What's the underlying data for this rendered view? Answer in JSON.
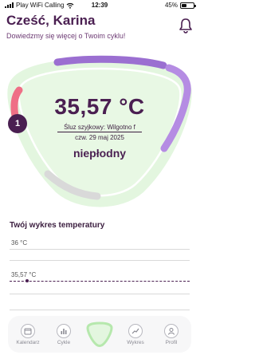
{
  "status_bar": {
    "carrier": "Play WiFi Calling",
    "time": "12:39",
    "battery": "45%",
    "battery_level": 0.45
  },
  "header": {
    "greeting": "Cześć, Karina",
    "subtitle": "Dowiedzmy się więcej o Twoim cyklu!",
    "notification_icon": "bell-icon"
  },
  "cycle": {
    "day": "1",
    "temperature": "35,57 °C",
    "mucus": "Śluz szyjkowy: Wilgotno  f",
    "date": "czw. 29 maj 2025",
    "fertility": "niepłodny",
    "colors": {
      "ring_background": "#e3f6df",
      "menstruation": "#ef6f86",
      "fertile": "#b58ce3",
      "upcoming": "#d9d9d9",
      "accent": "#4a1f51"
    }
  },
  "temperature_chart": {
    "title": "Twój wykres temperatury",
    "labels": [
      "36 °C",
      "35,57 °C"
    ]
  },
  "tab_bar": {
    "items": [
      {
        "label": "Kalendarz",
        "icon": "calendar-icon"
      },
      {
        "label": "Cykle",
        "icon": "chart-icon"
      },
      {
        "label": "",
        "icon": "cycle-ring-icon"
      },
      {
        "label": "Wykres",
        "icon": "trend-icon"
      },
      {
        "label": "Profil",
        "icon": "profile-icon"
      }
    ]
  }
}
